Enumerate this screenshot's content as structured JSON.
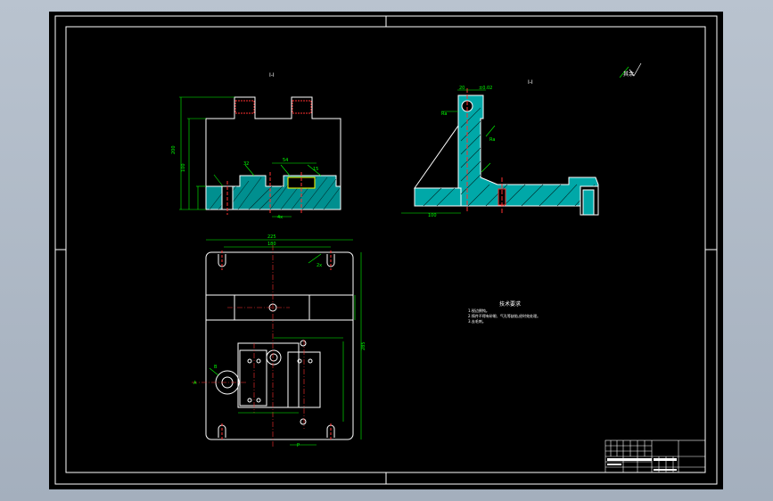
{
  "colors": {
    "background": "#000000",
    "outline": "#ffffff",
    "dimension": "#00ff00",
    "hatch": "#00c8c8",
    "centerline": "#ff3030",
    "magenta": "#ff00ff",
    "yellow": "#ffff00",
    "window": "#b4bfcc"
  },
  "drawing": {
    "section_label_front": "I-I",
    "section_label_side": "I-I",
    "roughness_note": "其余",
    "tech_req_title": "技术要求",
    "tech_req_lines": [
      "1.锐边倒钝。",
      "2.铸件不得有砂眼、气孔等缺陷,经时效处理。",
      "3.去毛刺。"
    ]
  },
  "title_block": {
    "rows": 6,
    "cols": 8
  }
}
